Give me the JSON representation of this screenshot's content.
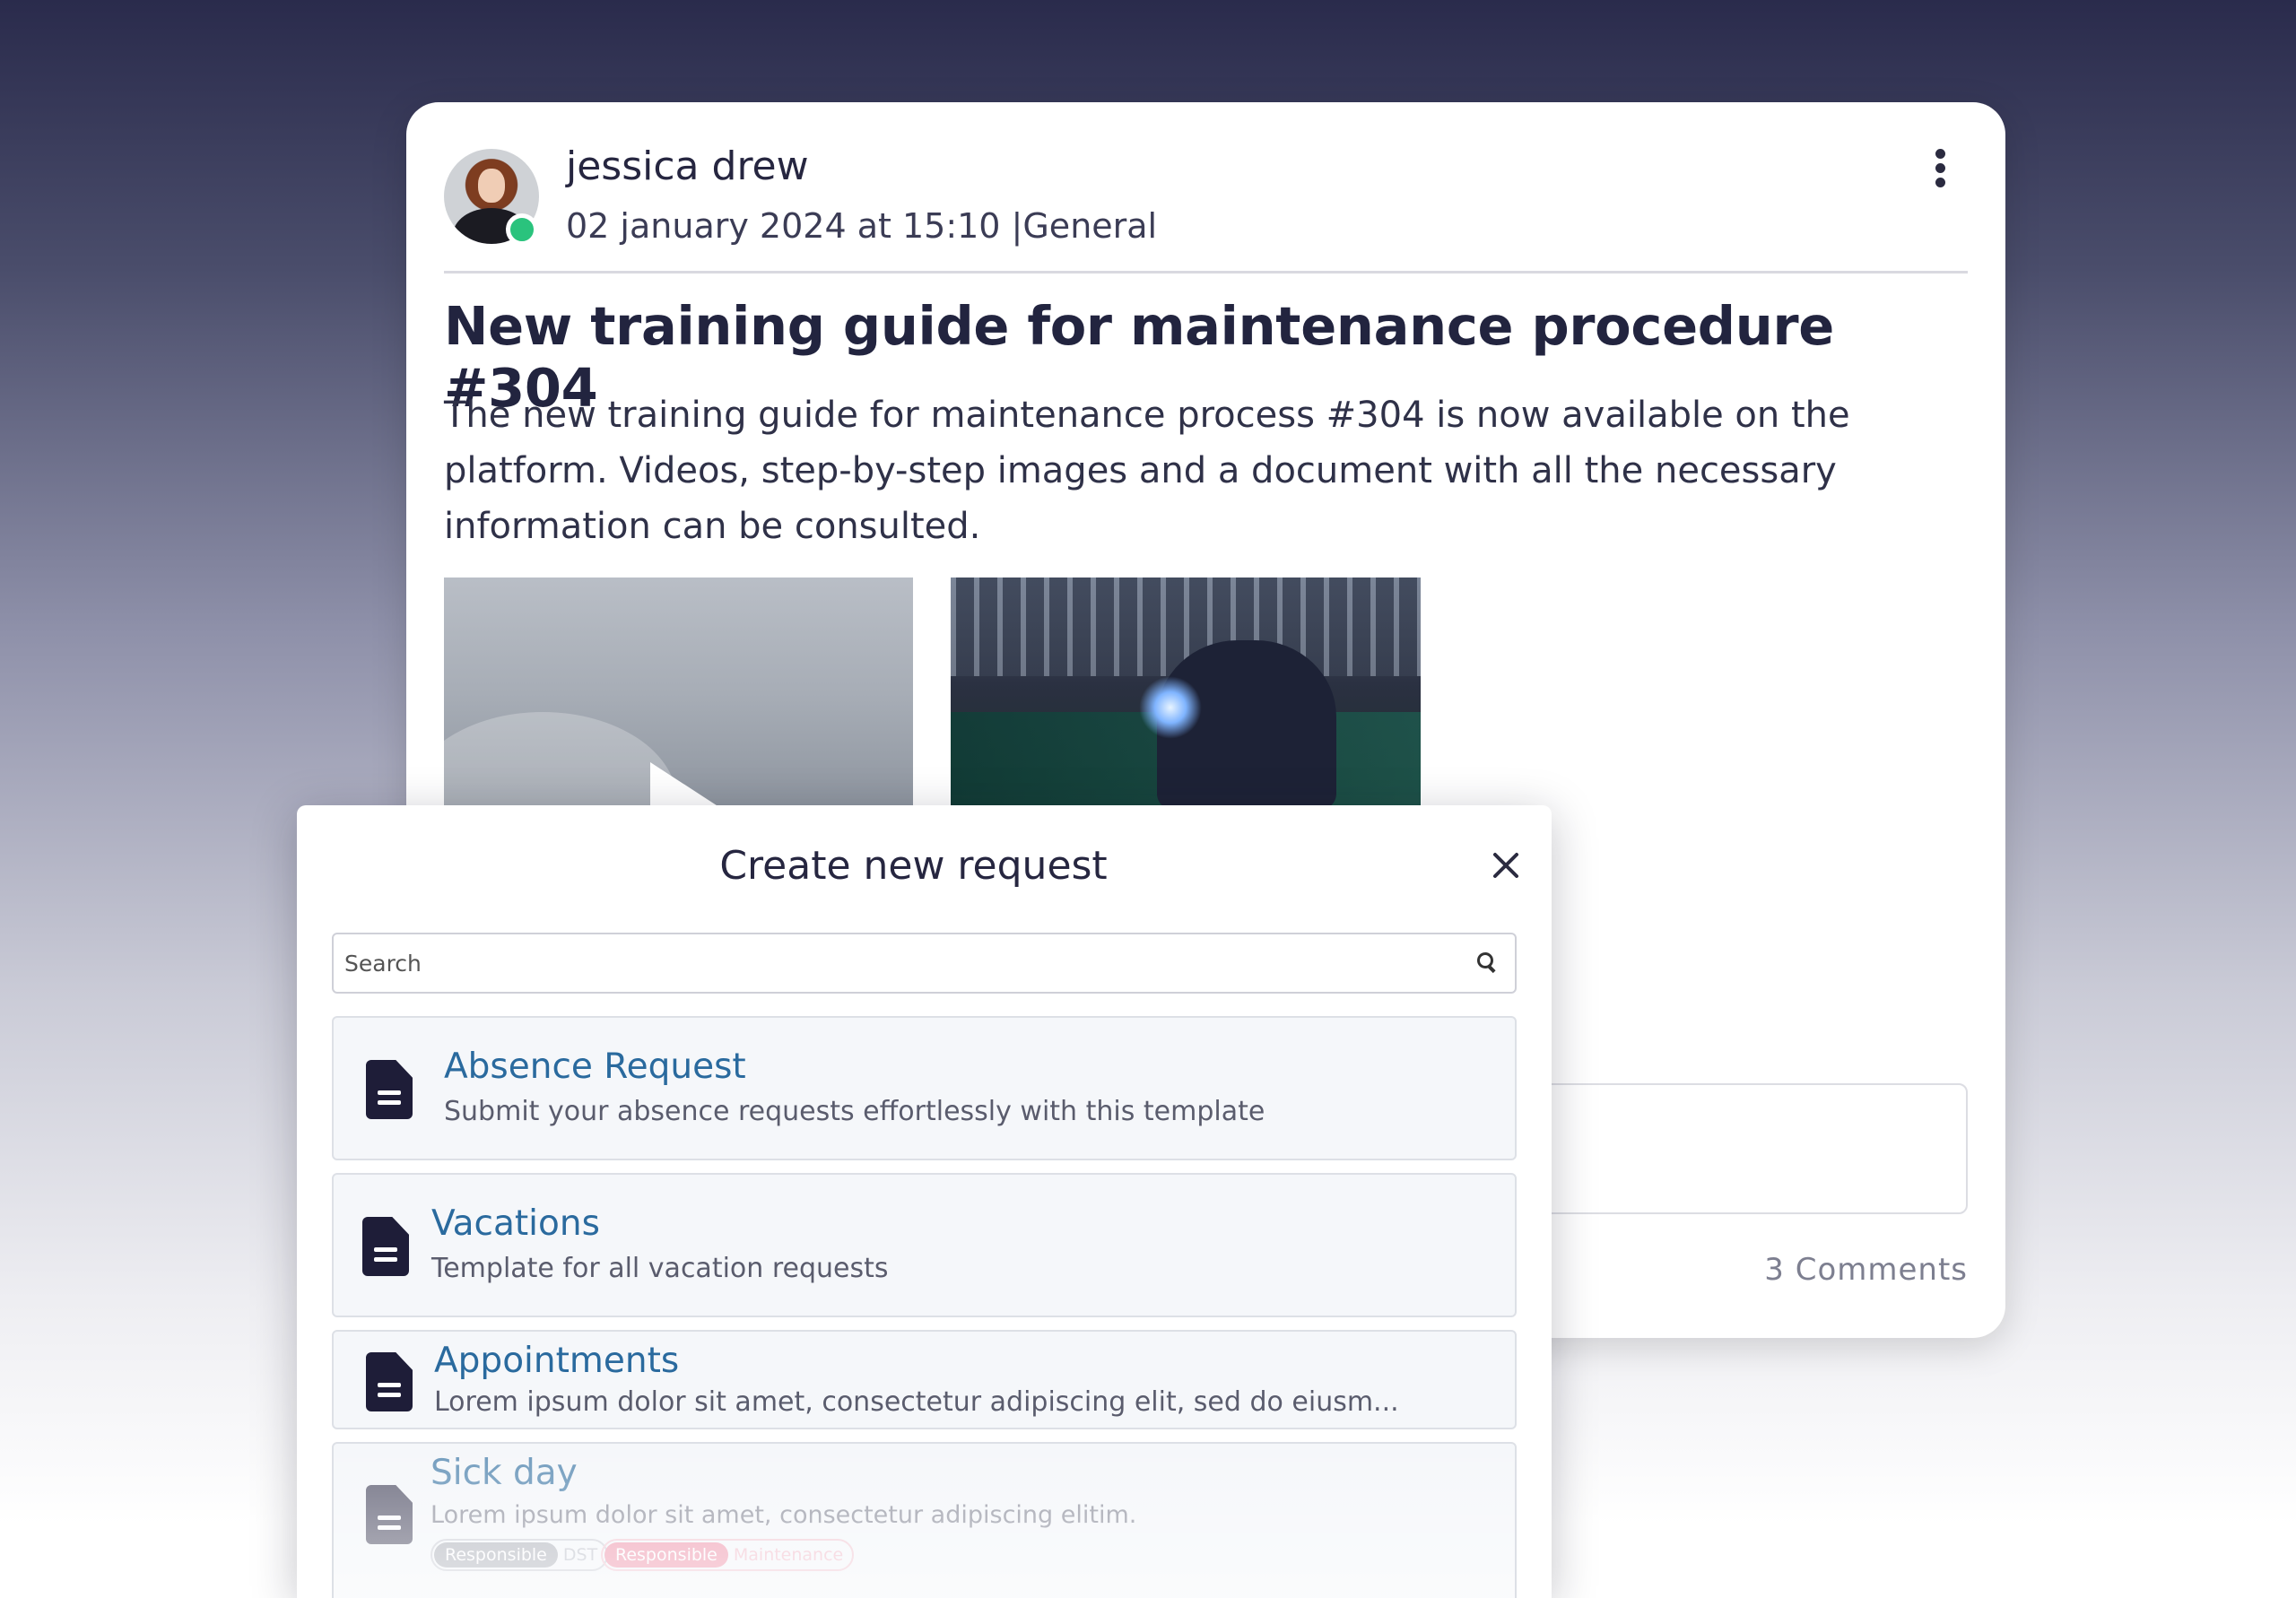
{
  "post": {
    "author": "jessica drew",
    "meta": "02 january 2024 at 15:10 |General",
    "title": "New training guide for maintenance procedure #304",
    "body": "The new training guide for maintenance process #304 is now available on the platform. Videos, step-by-step images and a document with all the necessary information can be consulted.",
    "comments": "3 Comments",
    "icons": {
      "menu": "kebab-menu-icon",
      "play": "play-icon",
      "status": "online-status-dot"
    },
    "colors": {
      "online": "#2ac37d"
    }
  },
  "modal": {
    "title": "Create new request",
    "search_placeholder": "Search",
    "items": [
      {
        "title": "Absence Request",
        "description": "Submit your absence requests effortlessly with this template"
      },
      {
        "title": "Vacations",
        "description": "Template for all vacation requests"
      },
      {
        "title": "Appointments",
        "description": "Lorem ipsum dolor sit amet, consectetur adipiscing elit, sed do eiusm..."
      },
      {
        "title": "Sick day",
        "description": "Lorem ipsum dolor sit amet, consectetur adipiscing elitim.",
        "tags": [
          {
            "label": "Responsible",
            "value": "DST"
          },
          {
            "label": "Responsible",
            "value": "Maintenance"
          }
        ]
      }
    ],
    "colors": {
      "item_title": "#2a6a9e",
      "tag_gray": "#a7abb4",
      "tag_pink": "#f08aa2"
    }
  }
}
